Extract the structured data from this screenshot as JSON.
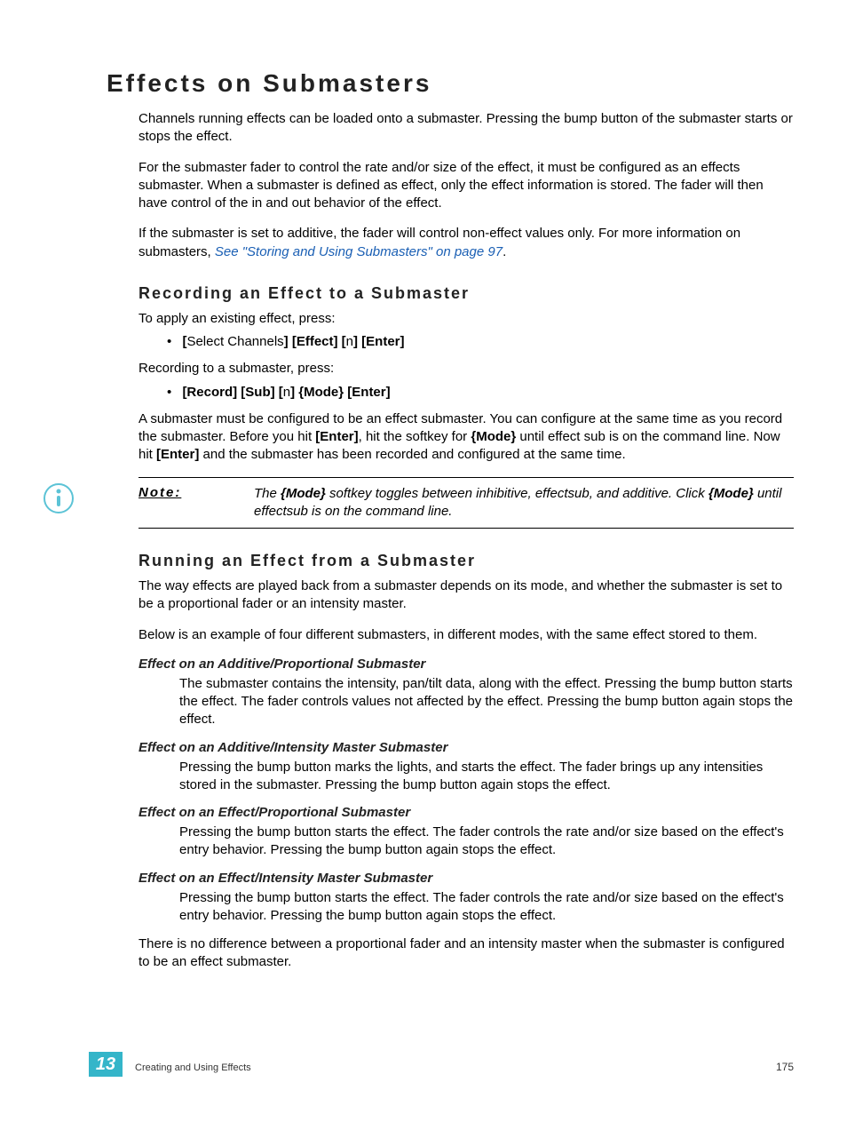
{
  "title": "Effects on Submasters",
  "intro": [
    "Channels running effects can be loaded onto a submaster. Pressing the bump button of the submaster starts or stops the effect.",
    "For the submaster fader to control the rate and/or size of the effect, it must be configured as an effects submaster. When a submaster is defined as effect, only the effect information is stored. The fader will then have control of the in and out behavior of the effect."
  ],
  "intro3_pre": "If the submaster is set to additive, the fader will control non-effect values only. For more information on submasters, ",
  "intro3_link": "See \"Storing and Using Submasters\" on page 97",
  "intro3_post": ".",
  "rec": {
    "heading": "Recording an Effect to a Submaster",
    "line1": "To apply an existing effect, press:",
    "bullet1": {
      "b1": "[",
      "t1": "Select Channels",
      "b2": "] [Effect] [",
      "t2": "n",
      "b3": "] [Enter]"
    },
    "line2": "Recording to a submaster, press:",
    "bullet2": {
      "b1": "[Record] [Sub] [",
      "t1": "n",
      "b2": "] {Mode} [Enter]"
    },
    "para_a": "A submaster must be configured to be an effect submaster. You can configure at the same time as you record the submaster. Before you hit ",
    "para_b": "[Enter]",
    "para_c": ", hit the softkey for ",
    "para_d": "{Mode}",
    "para_e": " until effect sub is on the command line. Now hit ",
    "para_f": "[Enter]",
    "para_g": " and the submaster has been recorded and configured at the same time."
  },
  "note": {
    "label": "Note:",
    "a": "The ",
    "b": "{Mode}",
    "c": " softkey toggles between inhibitive, effectsub, and additive. Click ",
    "d": "{Mode}",
    "e": " until effectsub is on the command line."
  },
  "run": {
    "heading": "Running an Effect from a Submaster",
    "p1": "The way effects are played back from a submaster depends on its mode, and whether the submaster is set to be a proportional fader or an intensity master.",
    "p2": "Below is an example of four different submasters, in different modes, with the same effect stored to them.",
    "items": [
      {
        "h": "Effect on an Additive/Proportional Submaster",
        "b": "The submaster contains the intensity, pan/tilt data, along with the effect. Pressing the bump button starts the effect. The fader controls values not affected by the effect. Pressing the bump button again stops the effect."
      },
      {
        "h": "Effect on an Additive/Intensity Master Submaster",
        "b": "Pressing the bump button marks the lights, and starts the effect. The fader brings up any intensities stored in the submaster. Pressing the bump button again stops the effect."
      },
      {
        "h": "Effect on an Effect/Proportional Submaster",
        "b": "Pressing the bump button starts the effect. The fader controls the rate and/or size based on the effect's entry behavior. Pressing the bump button again stops the effect."
      },
      {
        "h": "Effect on an Effect/Intensity Master Submaster",
        "b": "Pressing the bump button starts the effect. The fader controls the rate and/or size based on the effect's entry behavior. Pressing the bump button again stops the effect."
      }
    ],
    "closing": "There is no difference between a proportional fader and an intensity master when the submaster is configured to be an effect submaster."
  },
  "footer": {
    "chapter": "13",
    "section": "Creating and Using Effects",
    "page": "175"
  }
}
